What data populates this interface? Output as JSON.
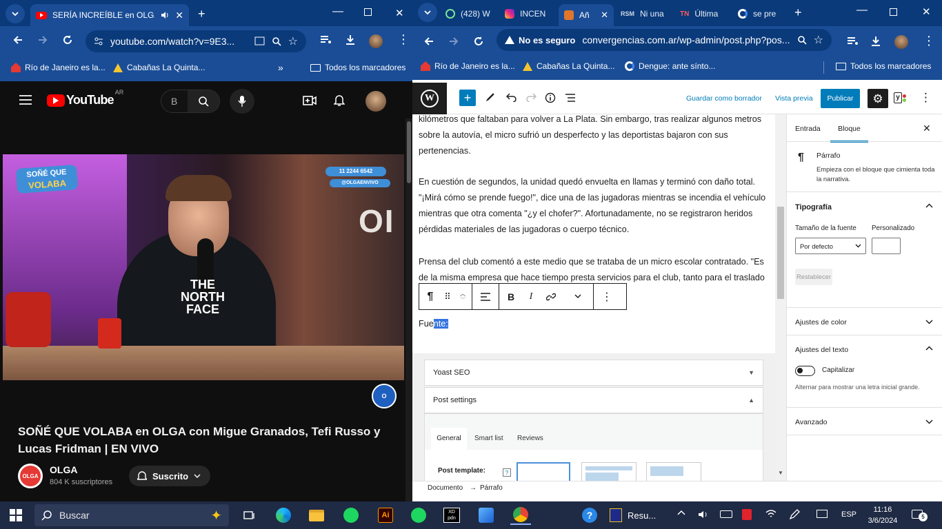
{
  "left_browser": {
    "tab_title": "SERÍA INCREÍBLE en OLGA y",
    "url": "youtube.com/watch?v=9E3...",
    "bookmarks": [
      "Río de Janeiro es la...",
      "Cabañas La Quinta..."
    ],
    "all_bookmarks": "Todos los marcadores"
  },
  "youtube": {
    "logo": "YouTube",
    "region": "AR",
    "search_placeholder": "B",
    "video_badge_line1": "SOÑÉ QUE",
    "video_badge_line2": "VOLABA",
    "phone": "11 2244 6542",
    "handle": "@OLGAENVIVO",
    "title": "SOÑÉ QUE VOLABA en OLGA con Migue Granados, Tefi Russo y Lucas Fridman | EN VIVO",
    "channel": "OLGA",
    "subscribers": "804 K suscriptores",
    "subscribe_label": "Suscrito"
  },
  "right_browser": {
    "tabs": [
      "(428) W",
      "INCEN",
      "Añ",
      "Ni una",
      "Última",
      "se pre"
    ],
    "security_label": "No es seguro",
    "url": "convergencias.com.ar/wp-admin/post.php?pos...",
    "bookmarks": [
      "Río de Janeiro es la...",
      "Cabañas La Quinta...",
      "Dengue: ante sínto..."
    ],
    "all_bookmarks": "Todos los marcadores"
  },
  "wp": {
    "save_draft": "Guardar como borrador",
    "preview": "Vista previa",
    "publish": "Publicar",
    "paragraphs": [
      "kilómetros que faltaban para volver a La Plata. Sin embargo, tras realizar algunos metros sobre la autovía, el micro sufrió un desperfecto y las deportistas bajaron con sus pertenencias.",
      "En cuestión de segundos, la unidad quedó envuelta en llamas y terminó con daño total. \"¡Mirá cómo se prende fuego!\", dice una de las jugadoras mientras se incendia el vehículo mientras que otra comenta \"¿y el chofer?\". Afortunadamente, no se registraron heridos pérdidas materiales de las jugadoras o cuerpo técnico.",
      "Prensa del club comentó a este medio que se trataba de un micro escolar contratado. \"Es de la misma empresa que hace tiempo presta servicios para el club, tanto para el traslado"
    ],
    "fuente_prefix": "Fue",
    "fuente_selected": "nte:",
    "yoast_label": "Yoast SEO",
    "post_settings": "Post settings",
    "ps_tabs": [
      "General",
      "Smart list",
      "Reviews"
    ],
    "post_template_label": "Post template:",
    "help": "?",
    "breadcrumb_doc": "Documento",
    "breadcrumb_arrow": "→",
    "breadcrumb_block": "Párrafo",
    "sidebar": {
      "tab_entry": "Entrada",
      "tab_block": "Bloque",
      "block_name": "Párrafo",
      "block_desc": "Empieza con el bloque que cimienta toda la narrativa.",
      "typography": "Tipografía",
      "font_size_label": "Tamaño de la fuente",
      "custom_label": "Personalizado",
      "font_size_value": "Por defecto",
      "reset": "Restablecer",
      "color_settings": "Ajustes de color",
      "text_settings": "Ajustes del texto",
      "capitalize": "Capitalizar",
      "capitalize_help": "Alternar para mostrar una letra inicial grande.",
      "advanced": "Avanzado"
    }
  },
  "taskbar": {
    "search": "Buscar",
    "app_label": "Resu...",
    "lang": "ESP",
    "time": "11:16",
    "date": "3/6/2024",
    "notif_count": "5"
  },
  "colors": {
    "chrome_dark": "#0a3a7a",
    "chrome_mid": "#1a4d96",
    "wp_blue": "#007cba",
    "yt_red": "#ff0000"
  }
}
